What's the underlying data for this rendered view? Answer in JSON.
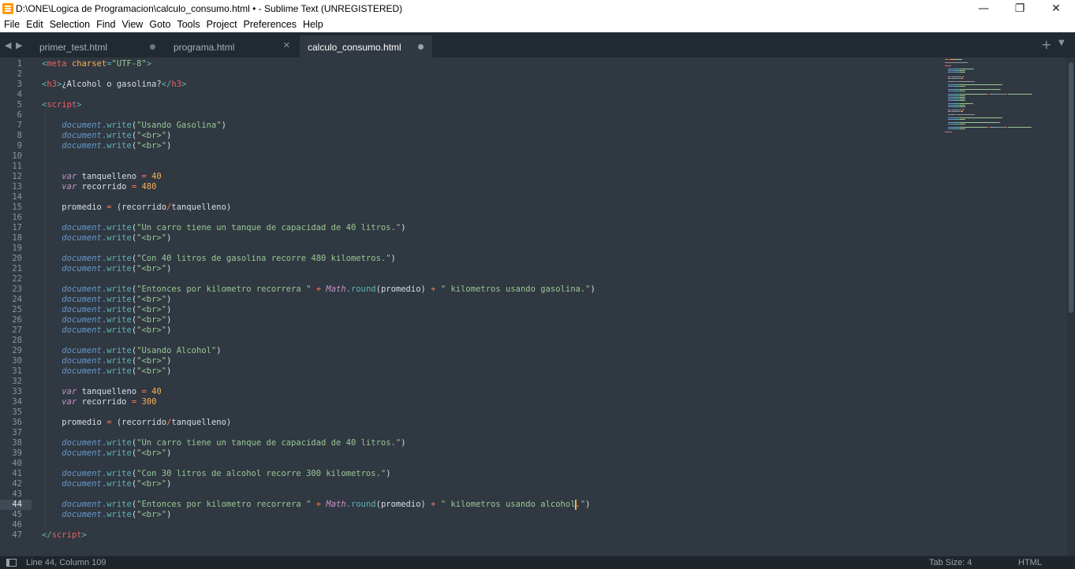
{
  "window": {
    "title": "D:\\ONE\\Logica de Programacion\\calculo_consumo.html • - Sublime Text (UNREGISTERED)",
    "minimize": "—",
    "maximize": "❐",
    "close": "✕"
  },
  "menu": [
    "File",
    "Edit",
    "Selection",
    "Find",
    "View",
    "Goto",
    "Tools",
    "Project",
    "Preferences",
    "Help"
  ],
  "tabs": [
    {
      "label": "primer_test.html",
      "state": "dirty"
    },
    {
      "label": "programa.html",
      "state": "close"
    },
    {
      "label": "calculo_consumo.html",
      "state": "dirty",
      "active": true
    }
  ],
  "editor": {
    "current_line": 44,
    "lines": [
      [
        [
          "t-punc",
          "<"
        ],
        [
          "t-tag",
          "meta"
        ],
        [
          "t-text",
          " "
        ],
        [
          "t-attr",
          "charset"
        ],
        [
          "t-punc",
          "="
        ],
        [
          "t-str",
          "\"UTF-8\""
        ],
        [
          "t-punc",
          ">"
        ]
      ],
      [],
      [
        [
          "t-punc",
          "<"
        ],
        [
          "t-tag",
          "h3"
        ],
        [
          "t-punc",
          ">"
        ],
        [
          "t-text",
          "¿Alcohol o gasolina?"
        ],
        [
          "t-punc",
          "</"
        ],
        [
          "t-tag",
          "h3"
        ],
        [
          "t-punc",
          ">"
        ]
      ],
      [],
      [
        [
          "t-punc",
          "<"
        ],
        [
          "t-tag",
          "script"
        ],
        [
          "t-punc",
          ">"
        ]
      ],
      [],
      [
        [
          "t-text",
          "    "
        ],
        [
          "t-obj",
          "document"
        ],
        [
          "t-punc",
          "."
        ],
        [
          "t-meth",
          "write"
        ],
        [
          "t-text",
          "("
        ],
        [
          "t-str",
          "\"Usando Gasolina\""
        ],
        [
          "t-text",
          ")"
        ]
      ],
      [
        [
          "t-text",
          "    "
        ],
        [
          "t-obj",
          "document"
        ],
        [
          "t-punc",
          "."
        ],
        [
          "t-meth",
          "write"
        ],
        [
          "t-text",
          "("
        ],
        [
          "t-str",
          "\"<br>\""
        ],
        [
          "t-text",
          ")"
        ]
      ],
      [
        [
          "t-text",
          "    "
        ],
        [
          "t-obj",
          "document"
        ],
        [
          "t-punc",
          "."
        ],
        [
          "t-meth",
          "write"
        ],
        [
          "t-text",
          "("
        ],
        [
          "t-str",
          "\"<br>\""
        ],
        [
          "t-text",
          ")"
        ]
      ],
      [],
      [],
      [
        [
          "t-text",
          "    "
        ],
        [
          "t-kw",
          "var"
        ],
        [
          "t-text",
          " tanquelleno "
        ],
        [
          "t-op",
          "="
        ],
        [
          "t-text",
          " "
        ],
        [
          "t-num",
          "40"
        ]
      ],
      [
        [
          "t-text",
          "    "
        ],
        [
          "t-kw",
          "var"
        ],
        [
          "t-text",
          " recorrido "
        ],
        [
          "t-op",
          "="
        ],
        [
          "t-text",
          " "
        ],
        [
          "t-num",
          "480"
        ]
      ],
      [],
      [
        [
          "t-text",
          "    promedio "
        ],
        [
          "t-op",
          "="
        ],
        [
          "t-text",
          " (recorrido"
        ],
        [
          "t-op",
          "/"
        ],
        [
          "t-text",
          "tanquelleno)"
        ]
      ],
      [],
      [
        [
          "t-text",
          "    "
        ],
        [
          "t-obj",
          "document"
        ],
        [
          "t-punc",
          "."
        ],
        [
          "t-meth",
          "write"
        ],
        [
          "t-text",
          "("
        ],
        [
          "t-str",
          "\"Un carro tiene un tanque de capacidad de 40 litros.\""
        ],
        [
          "t-text",
          ")"
        ]
      ],
      [
        [
          "t-text",
          "    "
        ],
        [
          "t-obj",
          "document"
        ],
        [
          "t-punc",
          "."
        ],
        [
          "t-meth",
          "write"
        ],
        [
          "t-text",
          "("
        ],
        [
          "t-str",
          "\"<br>\""
        ],
        [
          "t-text",
          ")"
        ]
      ],
      [],
      [
        [
          "t-text",
          "    "
        ],
        [
          "t-obj",
          "document"
        ],
        [
          "t-punc",
          "."
        ],
        [
          "t-meth",
          "write"
        ],
        [
          "t-text",
          "("
        ],
        [
          "t-str",
          "\"Con 40 litros de gasolina recorre 480 kilometros.\""
        ],
        [
          "t-text",
          ")"
        ]
      ],
      [
        [
          "t-text",
          "    "
        ],
        [
          "t-obj",
          "document"
        ],
        [
          "t-punc",
          "."
        ],
        [
          "t-meth",
          "write"
        ],
        [
          "t-text",
          "("
        ],
        [
          "t-str",
          "\"<br>\""
        ],
        [
          "t-text",
          ")"
        ]
      ],
      [],
      [
        [
          "t-text",
          "    "
        ],
        [
          "t-obj",
          "document"
        ],
        [
          "t-punc",
          "."
        ],
        [
          "t-meth",
          "write"
        ],
        [
          "t-text",
          "("
        ],
        [
          "t-str",
          "\"Entonces por kilometro recorrera \""
        ],
        [
          "t-text",
          " "
        ],
        [
          "t-op",
          "+"
        ],
        [
          "t-text",
          " "
        ],
        [
          "t-math",
          "Math"
        ],
        [
          "t-punc",
          "."
        ],
        [
          "t-meth",
          "round"
        ],
        [
          "t-text",
          "(promedio) "
        ],
        [
          "t-op",
          "+"
        ],
        [
          "t-text",
          " "
        ],
        [
          "t-str",
          "\" kilometros usando gasolina.\""
        ],
        [
          "t-text",
          ")"
        ]
      ],
      [
        [
          "t-text",
          "    "
        ],
        [
          "t-obj",
          "document"
        ],
        [
          "t-punc",
          "."
        ],
        [
          "t-meth",
          "write"
        ],
        [
          "t-text",
          "("
        ],
        [
          "t-str",
          "\"<br>\""
        ],
        [
          "t-text",
          ")"
        ]
      ],
      [
        [
          "t-text",
          "    "
        ],
        [
          "t-obj",
          "document"
        ],
        [
          "t-punc",
          "."
        ],
        [
          "t-meth",
          "write"
        ],
        [
          "t-text",
          "("
        ],
        [
          "t-str",
          "\"<br>\""
        ],
        [
          "t-text",
          ")"
        ]
      ],
      [
        [
          "t-text",
          "    "
        ],
        [
          "t-obj",
          "document"
        ],
        [
          "t-punc",
          "."
        ],
        [
          "t-meth",
          "write"
        ],
        [
          "t-text",
          "("
        ],
        [
          "t-str",
          "\"<br>\""
        ],
        [
          "t-text",
          ")"
        ]
      ],
      [
        [
          "t-text",
          "    "
        ],
        [
          "t-obj",
          "document"
        ],
        [
          "t-punc",
          "."
        ],
        [
          "t-meth",
          "write"
        ],
        [
          "t-text",
          "("
        ],
        [
          "t-str",
          "\"<br>\""
        ],
        [
          "t-text",
          ")"
        ]
      ],
      [],
      [
        [
          "t-text",
          "    "
        ],
        [
          "t-obj",
          "document"
        ],
        [
          "t-punc",
          "."
        ],
        [
          "t-meth",
          "write"
        ],
        [
          "t-text",
          "("
        ],
        [
          "t-str",
          "\"Usando Alcohol\""
        ],
        [
          "t-text",
          ")"
        ]
      ],
      [
        [
          "t-text",
          "    "
        ],
        [
          "t-obj",
          "document"
        ],
        [
          "t-punc",
          "."
        ],
        [
          "t-meth",
          "write"
        ],
        [
          "t-text",
          "("
        ],
        [
          "t-str",
          "\"<br>\""
        ],
        [
          "t-text",
          ")"
        ]
      ],
      [
        [
          "t-text",
          "    "
        ],
        [
          "t-obj",
          "document"
        ],
        [
          "t-punc",
          "."
        ],
        [
          "t-meth",
          "write"
        ],
        [
          "t-text",
          "("
        ],
        [
          "t-str",
          "\"<br>\""
        ],
        [
          "t-text",
          ")"
        ]
      ],
      [],
      [
        [
          "t-text",
          "    "
        ],
        [
          "t-kw",
          "var"
        ],
        [
          "t-text",
          " tanquelleno "
        ],
        [
          "t-op",
          "="
        ],
        [
          "t-text",
          " "
        ],
        [
          "t-num",
          "40"
        ]
      ],
      [
        [
          "t-text",
          "    "
        ],
        [
          "t-kw",
          "var"
        ],
        [
          "t-text",
          " recorrido "
        ],
        [
          "t-op",
          "="
        ],
        [
          "t-text",
          " "
        ],
        [
          "t-num",
          "300"
        ]
      ],
      [],
      [
        [
          "t-text",
          "    promedio "
        ],
        [
          "t-op",
          "="
        ],
        [
          "t-text",
          " (recorrido"
        ],
        [
          "t-op",
          "/"
        ],
        [
          "t-text",
          "tanquelleno)"
        ]
      ],
      [],
      [
        [
          "t-text",
          "    "
        ],
        [
          "t-obj",
          "document"
        ],
        [
          "t-punc",
          "."
        ],
        [
          "t-meth",
          "write"
        ],
        [
          "t-text",
          "("
        ],
        [
          "t-str",
          "\"Un carro tiene un tanque de capacidad de 40 litros.\""
        ],
        [
          "t-text",
          ")"
        ]
      ],
      [
        [
          "t-text",
          "    "
        ],
        [
          "t-obj",
          "document"
        ],
        [
          "t-punc",
          "."
        ],
        [
          "t-meth",
          "write"
        ],
        [
          "t-text",
          "("
        ],
        [
          "t-str",
          "\"<br>\""
        ],
        [
          "t-text",
          ")"
        ]
      ],
      [],
      [
        [
          "t-text",
          "    "
        ],
        [
          "t-obj",
          "document"
        ],
        [
          "t-punc",
          "."
        ],
        [
          "t-meth",
          "write"
        ],
        [
          "t-text",
          "("
        ],
        [
          "t-str",
          "\"Con 30 litros de alcohol recorre 300 kilometros.\""
        ],
        [
          "t-text",
          ")"
        ]
      ],
      [
        [
          "t-text",
          "    "
        ],
        [
          "t-obj",
          "document"
        ],
        [
          "t-punc",
          "."
        ],
        [
          "t-meth",
          "write"
        ],
        [
          "t-text",
          "("
        ],
        [
          "t-str",
          "\"<br>\""
        ],
        [
          "t-text",
          ")"
        ]
      ],
      [],
      [
        [
          "t-text",
          "    "
        ],
        [
          "t-obj",
          "document"
        ],
        [
          "t-punc",
          "."
        ],
        [
          "t-meth",
          "write"
        ],
        [
          "t-text",
          "("
        ],
        [
          "t-str",
          "\"Entonces por kilometro recorrera \""
        ],
        [
          "t-text",
          " "
        ],
        [
          "t-op",
          "+"
        ],
        [
          "t-text",
          " "
        ],
        [
          "t-math",
          "Math"
        ],
        [
          "t-punc",
          "."
        ],
        [
          "t-meth",
          "round"
        ],
        [
          "t-text",
          "(promedio) "
        ],
        [
          "t-op",
          "+"
        ],
        [
          "t-text",
          " "
        ],
        [
          "t-str",
          "\" kilometros usando alcohol.\""
        ],
        [
          "t-text",
          ")"
        ]
      ],
      [
        [
          "t-text",
          "    "
        ],
        [
          "t-obj",
          "document"
        ],
        [
          "t-punc",
          "."
        ],
        [
          "t-meth",
          "write"
        ],
        [
          "t-text",
          "("
        ],
        [
          "t-str",
          "\"<br>\""
        ],
        [
          "t-text",
          ")"
        ]
      ],
      [],
      [
        [
          "t-punc",
          "</"
        ],
        [
          "t-tag",
          "script"
        ],
        [
          "t-punc",
          ">"
        ]
      ]
    ]
  },
  "status": {
    "position": "Line 44, Column 109",
    "tab_size": "Tab Size: 4",
    "syntax": "HTML"
  }
}
